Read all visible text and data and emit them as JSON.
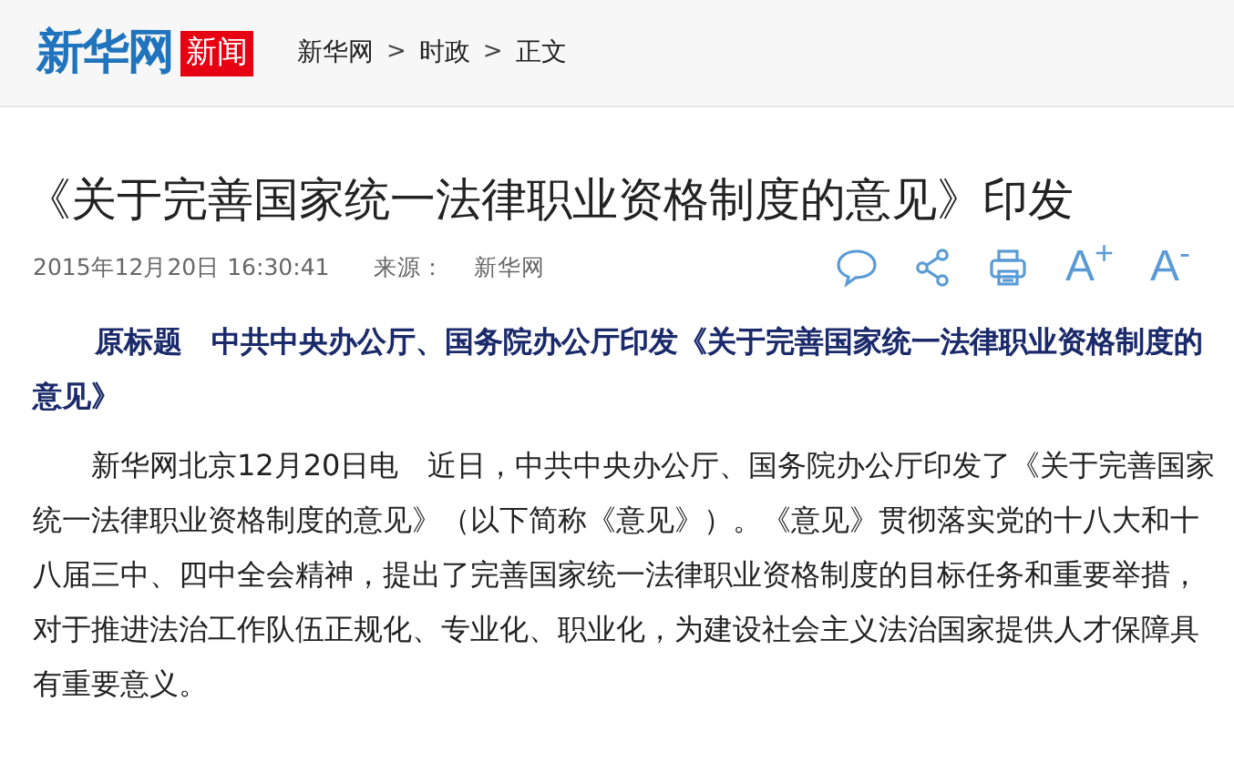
{
  "header": {
    "logo": "新华网",
    "channel": "新闻",
    "breadcrumb": [
      {
        "label": "新华网"
      },
      {
        "label": "时政"
      },
      {
        "label": "正文"
      }
    ],
    "separators": [
      ">",
      ">"
    ]
  },
  "article": {
    "title": "《关于完善国家统一法律职业资格制度的意见》印发",
    "datetime": "2015年12月20日 16:30:41",
    "source_label": "来源：",
    "source": "新华网",
    "tools": [
      {
        "kind": "comment"
      },
      {
        "kind": "share"
      },
      {
        "kind": "print"
      },
      {
        "kind": "text",
        "label": "A$^{+}$"
      },
      {
        "kind": "text",
        "label": "A$^{-}$"
      }
    ],
    "summary": "原标题　中共中央办公厅、国务院办公厅印发《关于完善国家统一法律职业资格制度的意见》",
    "paragraphs": [
      "新华网北京12月20日电　近日，中共中央办公厅、国务院办公厅印发了《关于完善国家统一法律职业资格制度的意见》（以下简称《意见》）。《意见》贯彻落实党的十八大和十八届三中、四中全会精神，提出了完善国家统一法律职业资格制度的目标任务和重要举措，对于推进法治工作队伍正规化、专业化、职业化，为建设社会主义法治国家提供人才保障具有重要意义。"
    ]
  }
}
